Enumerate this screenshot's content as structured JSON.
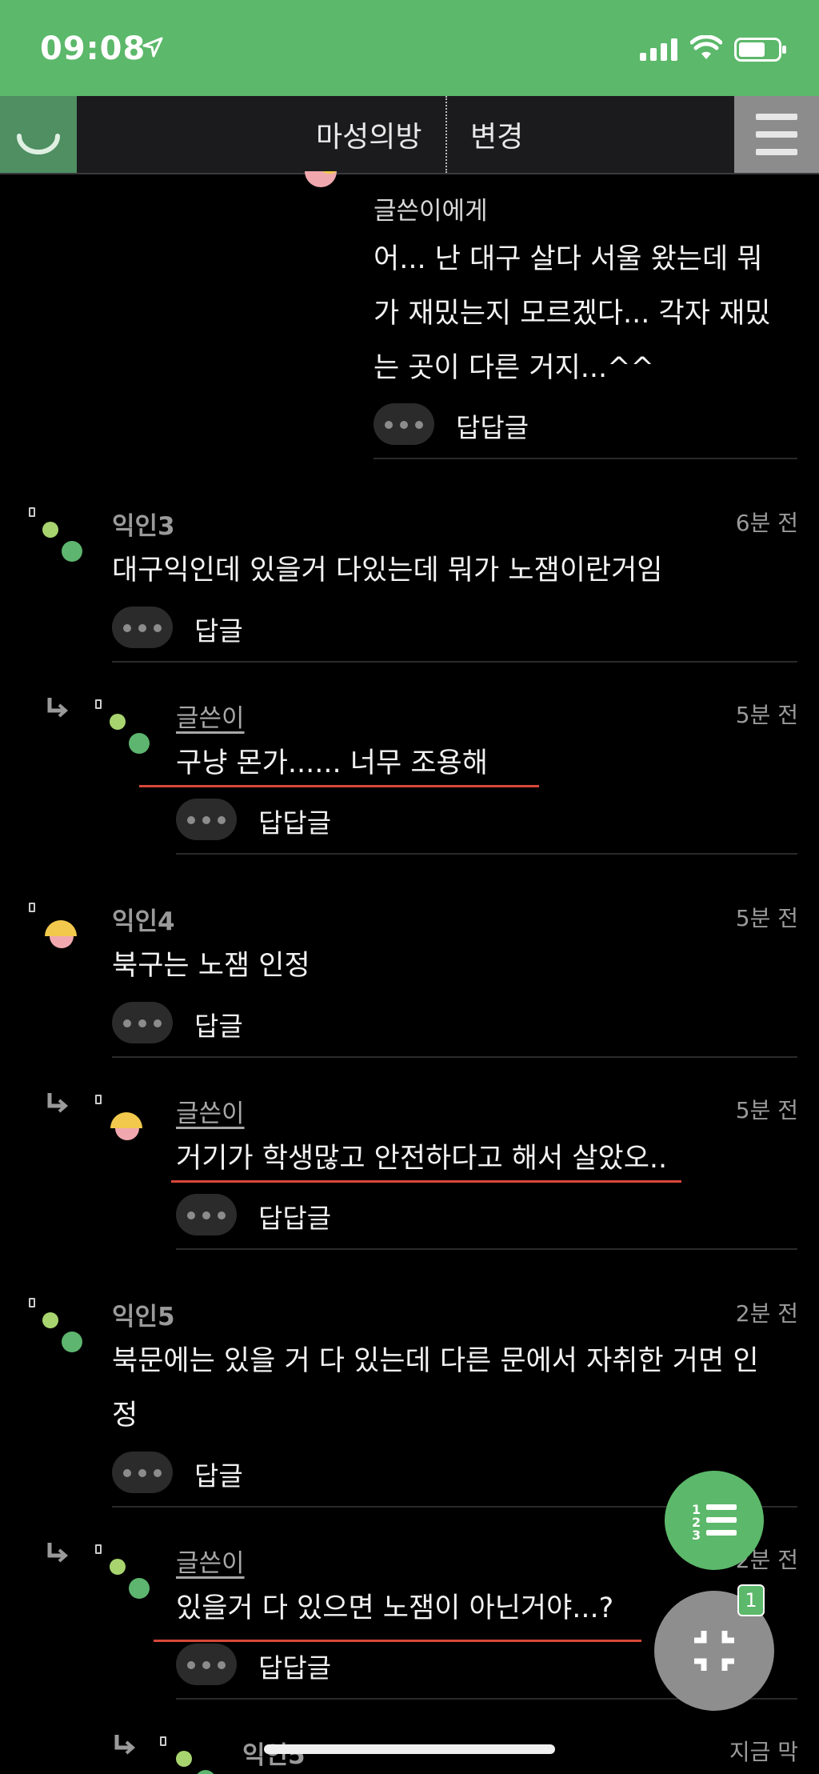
{
  "status_bar": {
    "time": "09:08"
  },
  "nav": {
    "title": "마성의방",
    "change_label": "변경"
  },
  "comments": [
    {
      "recipient": "글쓴이에게",
      "lines": [
        "어... 난 대구 살다 서울 왔는데 뭐",
        "가 재밌는지 모르겠다... 각자 재밌",
        "는 곳이 다른 거지...^^"
      ],
      "reply_label": "답답글"
    },
    {
      "author": "익인3",
      "time": "6분 전",
      "text": "대구익인데 있을거 다있는데 뭐가 노잼이란거임",
      "reply_label": "답글"
    },
    {
      "author": "글쓴이",
      "time": "5분 전",
      "text": "구냥 몬가...... 너무 조용해",
      "reply_label": "답답글"
    },
    {
      "author": "익인4",
      "time": "5분 전",
      "text": "북구는 노잼 인정",
      "reply_label": "답글"
    },
    {
      "author": "글쓴이",
      "time": "5분 전",
      "text": "거기가 학생많고 안전하다고 해서 살았오..",
      "reply_label": "답답글"
    },
    {
      "author": "익인5",
      "time": "2분 전",
      "lines": [
        "북문에는 있을 거 다 있는데 다른 문에서 자취한 거면 인",
        "정"
      ],
      "reply_label": "답글"
    },
    {
      "author": "글쓴이",
      "time": "2분 전",
      "text": "있을거 다 있으면 노잼이 아닌거야...?",
      "reply_label": "답답글"
    },
    {
      "author": "익인5",
      "time": "지금 막"
    }
  ],
  "fab": {
    "badge_count": "1"
  },
  "colors": {
    "accent_green": "#5cb86a",
    "underline_red": "#d8473a",
    "background": "#000000"
  }
}
